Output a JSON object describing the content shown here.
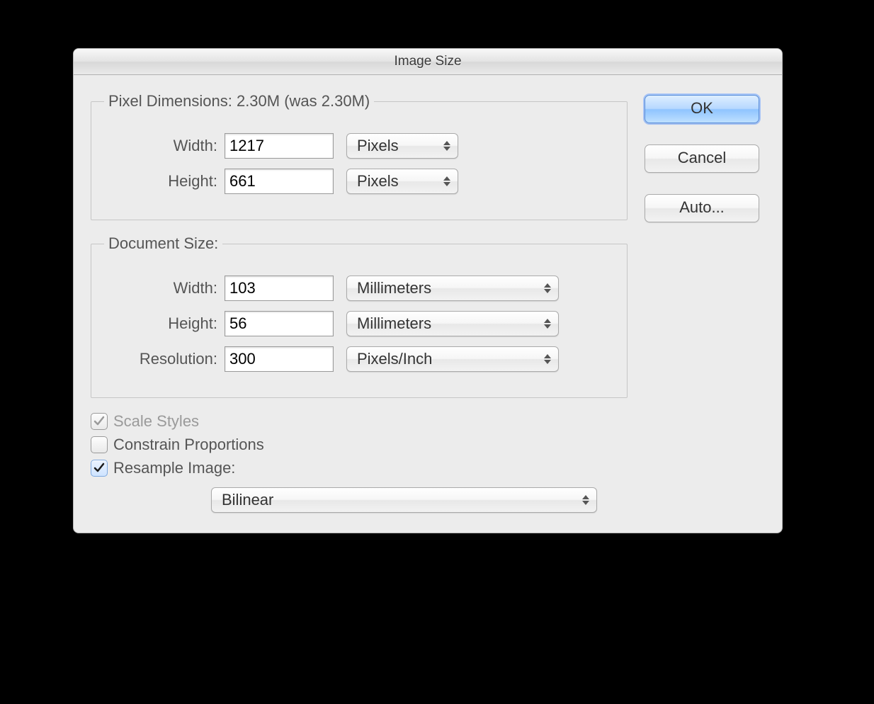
{
  "title": "Image Size",
  "pixel_dimensions": {
    "legend": "Pixel Dimensions:  2.30M (was 2.30M)",
    "width_label": "Width:",
    "width_value": "1217",
    "width_unit": "Pixels",
    "height_label": "Height:",
    "height_value": "661",
    "height_unit": "Pixels"
  },
  "document_size": {
    "legend": "Document Size:",
    "width_label": "Width:",
    "width_value": "103",
    "width_unit": "Millimeters",
    "height_label": "Height:",
    "height_value": "56",
    "height_unit": "Millimeters",
    "resolution_label": "Resolution:",
    "resolution_value": "300",
    "resolution_unit": "Pixels/Inch"
  },
  "checkboxes": {
    "scale_styles": {
      "label": "Scale Styles",
      "checked": true,
      "disabled": true
    },
    "constrain": {
      "label": "Constrain Proportions",
      "checked": false,
      "disabled": false
    },
    "resample": {
      "label": "Resample Image:",
      "checked": true,
      "disabled": false
    }
  },
  "resample_method": "Bilinear",
  "buttons": {
    "ok": "OK",
    "cancel": "Cancel",
    "auto": "Auto..."
  }
}
